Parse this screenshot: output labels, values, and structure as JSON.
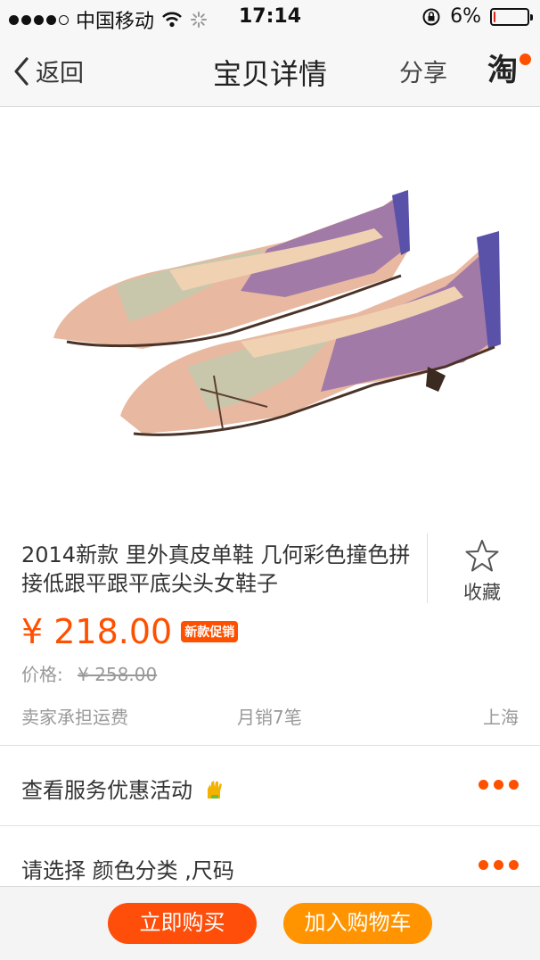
{
  "status_bar": {
    "carrier": "中国移动",
    "time": "17:14",
    "battery_text": "6%",
    "battery_level": 0.06
  },
  "nav": {
    "back_label": "返回",
    "title": "宝贝详情",
    "share_label": "分享",
    "taobao_label": "淘"
  },
  "product": {
    "title": "2014新款 里外真皮单鞋 几何彩色撞色拼接低跟平跟平底尖头女鞋子",
    "favorite_label": "收藏",
    "price": "¥ 218.00",
    "promo_badge": "新款促销",
    "original_price_label": "价格:",
    "original_price": "¥ 258.00",
    "shipping": "卖家承担运费",
    "monthly_sales": "月销7笔",
    "location": "上海"
  },
  "sections": {
    "service_label": "查看服务优惠活动",
    "select_label": "请选择 颜色分类 ,尺码"
  },
  "actions": {
    "buy_now": "立即购买",
    "add_to_cart": "加入购物车"
  },
  "colors": {
    "accent": "#ff5000",
    "buy_button": "#ff4d0a",
    "cart_button": "#ff9400"
  }
}
